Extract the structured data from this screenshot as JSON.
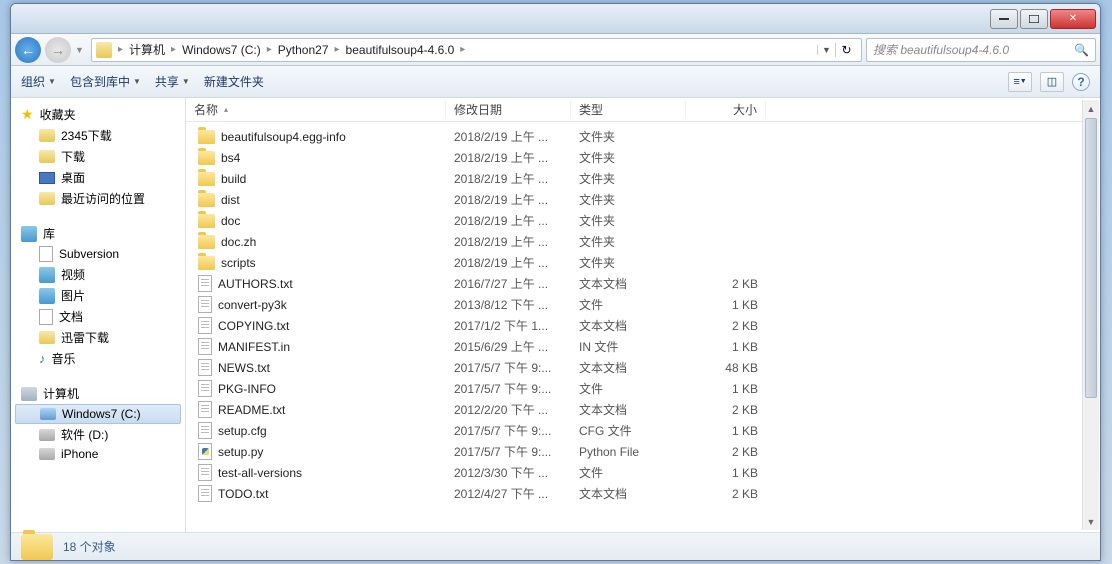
{
  "breadcrumb": {
    "items": [
      "计算机",
      "Windows7 (C:)",
      "Python27",
      "beautifulsoup4-4.6.0"
    ]
  },
  "search": {
    "placeholder": "搜索 beautifulsoup4-4.6.0"
  },
  "toolbar": {
    "organize": "组织",
    "include": "包含到库中",
    "share": "共享",
    "newfolder": "新建文件夹"
  },
  "sidebar": {
    "favorites": {
      "label": "收藏夹",
      "items": [
        "2345下载",
        "下载",
        "桌面",
        "最近访问的位置"
      ]
    },
    "libraries": {
      "label": "库",
      "items": [
        "Subversion",
        "视频",
        "图片",
        "文档",
        "迅雷下载",
        "音乐"
      ]
    },
    "computer": {
      "label": "计算机",
      "items": [
        "Windows7 (C:)",
        "软件 (D:)",
        "iPhone"
      ]
    }
  },
  "columns": {
    "name": "名称",
    "date": "修改日期",
    "type": "类型",
    "size": "大小"
  },
  "files": [
    {
      "name": "beautifulsoup4.egg-info",
      "date": "2018/2/19 上午 ...",
      "type": "文件夹",
      "size": "",
      "icon": "folder"
    },
    {
      "name": "bs4",
      "date": "2018/2/19 上午 ...",
      "type": "文件夹",
      "size": "",
      "icon": "folder"
    },
    {
      "name": "build",
      "date": "2018/2/19 上午 ...",
      "type": "文件夹",
      "size": "",
      "icon": "folder"
    },
    {
      "name": "dist",
      "date": "2018/2/19 上午 ...",
      "type": "文件夹",
      "size": "",
      "icon": "folder"
    },
    {
      "name": "doc",
      "date": "2018/2/19 上午 ...",
      "type": "文件夹",
      "size": "",
      "icon": "folder"
    },
    {
      "name": "doc.zh",
      "date": "2018/2/19 上午 ...",
      "type": "文件夹",
      "size": "",
      "icon": "folder"
    },
    {
      "name": "scripts",
      "date": "2018/2/19 上午 ...",
      "type": "文件夹",
      "size": "",
      "icon": "folder"
    },
    {
      "name": "AUTHORS.txt",
      "date": "2016/7/27 上午 ...",
      "type": "文本文档",
      "size": "2 KB",
      "icon": "txt"
    },
    {
      "name": "convert-py3k",
      "date": "2013/8/12 下午 ...",
      "type": "文件",
      "size": "1 KB",
      "icon": "txt"
    },
    {
      "name": "COPYING.txt",
      "date": "2017/1/2 下午 1...",
      "type": "文本文档",
      "size": "2 KB",
      "icon": "txt"
    },
    {
      "name": "MANIFEST.in",
      "date": "2015/6/29 上午 ...",
      "type": "IN 文件",
      "size": "1 KB",
      "icon": "txt"
    },
    {
      "name": "NEWS.txt",
      "date": "2017/5/7 下午 9:...",
      "type": "文本文档",
      "size": "48 KB",
      "icon": "txt"
    },
    {
      "name": "PKG-INFO",
      "date": "2017/5/7 下午 9:...",
      "type": "文件",
      "size": "1 KB",
      "icon": "txt"
    },
    {
      "name": "README.txt",
      "date": "2012/2/20 下午 ...",
      "type": "文本文档",
      "size": "2 KB",
      "icon": "txt"
    },
    {
      "name": "setup.cfg",
      "date": "2017/5/7 下午 9:...",
      "type": "CFG 文件",
      "size": "1 KB",
      "icon": "txt"
    },
    {
      "name": "setup.py",
      "date": "2017/5/7 下午 9:...",
      "type": "Python File",
      "size": "2 KB",
      "icon": "py"
    },
    {
      "name": "test-all-versions",
      "date": "2012/3/30 下午 ...",
      "type": "文件",
      "size": "1 KB",
      "icon": "txt"
    },
    {
      "name": "TODO.txt",
      "date": "2012/4/27 下午 ...",
      "type": "文本文档",
      "size": "2 KB",
      "icon": "txt"
    }
  ],
  "status": {
    "count": "18 个对象"
  }
}
